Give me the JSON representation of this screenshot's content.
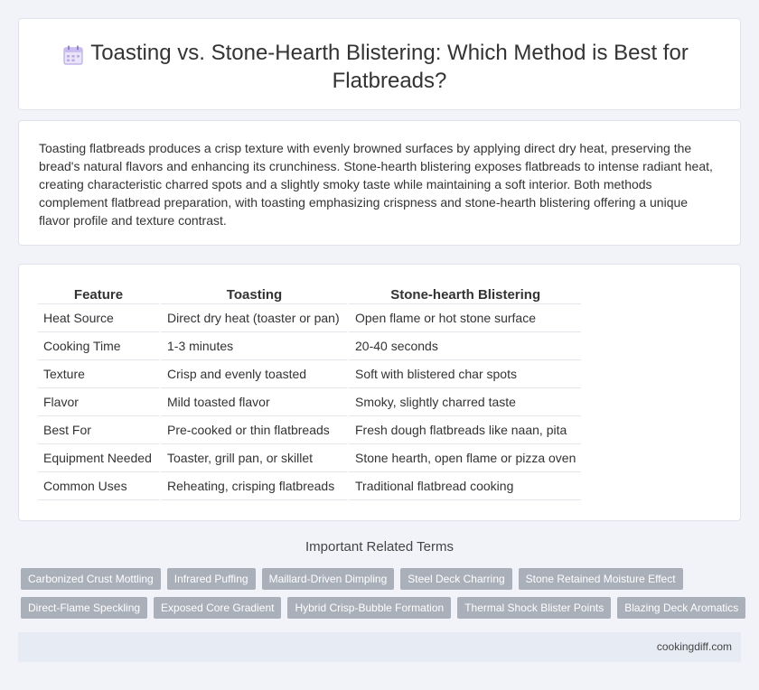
{
  "header": {
    "title": "Toasting vs. Stone-Hearth Blistering: Which Method is Best for Flatbreads?",
    "icon": "calendar-icon"
  },
  "intro": {
    "text": "Toasting flatbreads produces a crisp texture with evenly browned surfaces by applying direct dry heat, preserving the bread's natural flavors and enhancing its crunchiness. Stone-hearth blistering exposes flatbreads to intense radiant heat, creating characteristic charred spots and a slightly smoky taste while maintaining a soft interior. Both methods complement flatbread preparation, with toasting emphasizing crispness and stone-hearth blistering offering a unique flavor profile and texture contrast."
  },
  "comparison": {
    "headers": [
      "Feature",
      "Toasting",
      "Stone-hearth Blistering"
    ],
    "rows": [
      [
        "Heat Source",
        "Direct dry heat (toaster or pan)",
        "Open flame or hot stone surface"
      ],
      [
        "Cooking Time",
        "1-3 minutes",
        "20-40 seconds"
      ],
      [
        "Texture",
        "Crisp and evenly toasted",
        "Soft with blistered char spots"
      ],
      [
        "Flavor",
        "Mild toasted flavor",
        "Smoky, slightly charred taste"
      ],
      [
        "Best For",
        "Pre-cooked or thin flatbreads",
        "Fresh dough flatbreads like naan, pita"
      ],
      [
        "Equipment Needed",
        "Toaster, grill pan, or skillet",
        "Stone hearth, open flame or pizza oven"
      ],
      [
        "Common Uses",
        "Reheating, crisping flatbreads",
        "Traditional flatbread cooking"
      ]
    ]
  },
  "related": {
    "heading": "Important Related Terms",
    "row1": [
      "Carbonized Crust Mottling",
      "Infrared Puffing",
      "Maillard-Driven Dimpling",
      "Steel Deck Charring",
      "Stone Retained Moisture Effect"
    ],
    "row2": [
      "Direct-Flame Speckling",
      "Exposed Core Gradient",
      "Hybrid Crisp-Bubble Formation",
      "Thermal Shock Blister Points",
      "Blazing Deck Aromatics"
    ]
  },
  "footer": {
    "site": "cookingdiff.com"
  },
  "colors": {
    "tag_bg": "#a9b0ba",
    "footer_bg": "#e7ebf4",
    "page_bg": "#f1f3f8"
  }
}
